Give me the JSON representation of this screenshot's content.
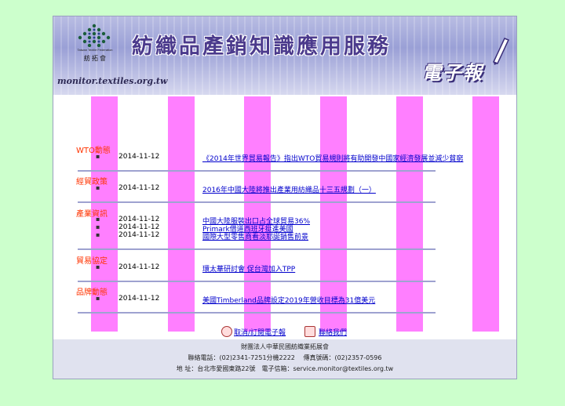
{
  "banner": {
    "title": "紡織品產銷知識應用服務",
    "subtitle": "電子報",
    "url": "monitor.textiles.org.tw",
    "logo_caption": "Taiwan Textile Federation",
    "logo_cn": "紡拓會"
  },
  "sections": [
    {
      "label": "WTO動態",
      "items": [
        {
          "date": "2014-11-12",
          "text": "《2014年世界貿易報告》指出WTO貿易規則將有助開發中國家經濟發展並減少貧窮"
        }
      ]
    },
    {
      "label": "經貿政策",
      "items": [
        {
          "date": "2014-11-12",
          "text": "2016年中國大陸將推出產業用紡織品十三五規劃（一）"
        }
      ]
    },
    {
      "label": "產業資訊",
      "items": [
        {
          "date": "2014-11-12",
          "text": "中國大陸服裝出口占全球貿易36%"
        },
        {
          "date": "2014-11-12",
          "text": "Primark借道西班牙挺進美國"
        },
        {
          "date": "2014-11-12",
          "text": "國際大型零售商看淡耶誕銷售前景"
        }
      ]
    },
    {
      "label": "貿易協定",
      "items": [
        {
          "date": "2014-11-12",
          "text": "環太華研討會 促台灣加入TPP"
        }
      ]
    },
    {
      "label": "品牌動態",
      "items": [
        {
          "date": "2014-11-12",
          "text": "美國Timberland品牌設定2019年營收目標為31億美元"
        }
      ]
    }
  ],
  "actions": {
    "subscribe": "取消/訂閱電子報",
    "contact": "聯絡我們"
  },
  "footer": {
    "org": "財團法人中華民國紡織業拓展會",
    "phone": "聯絡電話：(02)2341-7251分機2222　 傳真號碼：(02)2357-0596",
    "address": "地  址：台北市愛國東路22號　電子信箱：service.monitor@textiles.org.tw"
  },
  "colors": {
    "background": "#ccffcc",
    "stripe": "#ff7fff",
    "section_label": "#ff3300",
    "link": "#0000cc"
  }
}
